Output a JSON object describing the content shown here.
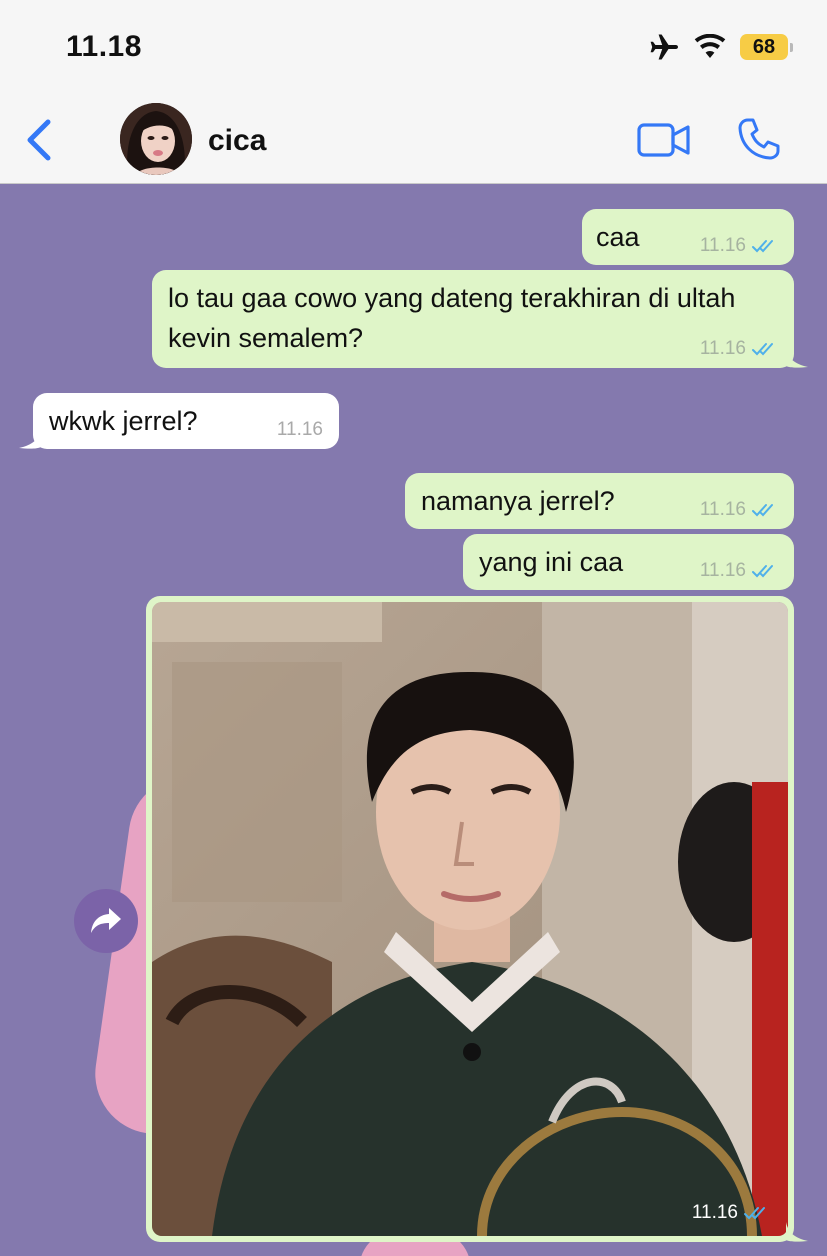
{
  "status_bar": {
    "time": "11.18",
    "battery_level": "68",
    "icons": [
      "airplane-icon",
      "wifi-icon",
      "battery-icon"
    ]
  },
  "header": {
    "contact_name": "cica",
    "back_icon": "chevron-left-icon",
    "video_icon": "video-camera-icon",
    "call_icon": "phone-icon"
  },
  "colors": {
    "accent": "#3478f6",
    "outgoing_bubble": "#dff5c8",
    "incoming_bubble": "#ffffff",
    "wallpaper": "#8479ae",
    "read_ticks": "#4fb0ea"
  },
  "messages": [
    {
      "direction": "outgoing",
      "text": "caa",
      "time": "11.16",
      "status": "read"
    },
    {
      "direction": "outgoing",
      "text": "lo tau gaa cowo yang dateng terakhiran di ultah kevin semalem?",
      "time": "11.16",
      "status": "read"
    },
    {
      "direction": "incoming",
      "text": "wkwk jerrel?",
      "time": "11.16"
    },
    {
      "direction": "outgoing",
      "text": "namanya jerrel?",
      "time": "11.16",
      "status": "read"
    },
    {
      "direction": "outgoing",
      "text": "yang ini caa",
      "time": "11.16",
      "status": "read"
    },
    {
      "direction": "outgoing",
      "type": "photo",
      "time": "11.16",
      "status": "read"
    }
  ],
  "forward_icon": "forward-arrow-icon"
}
